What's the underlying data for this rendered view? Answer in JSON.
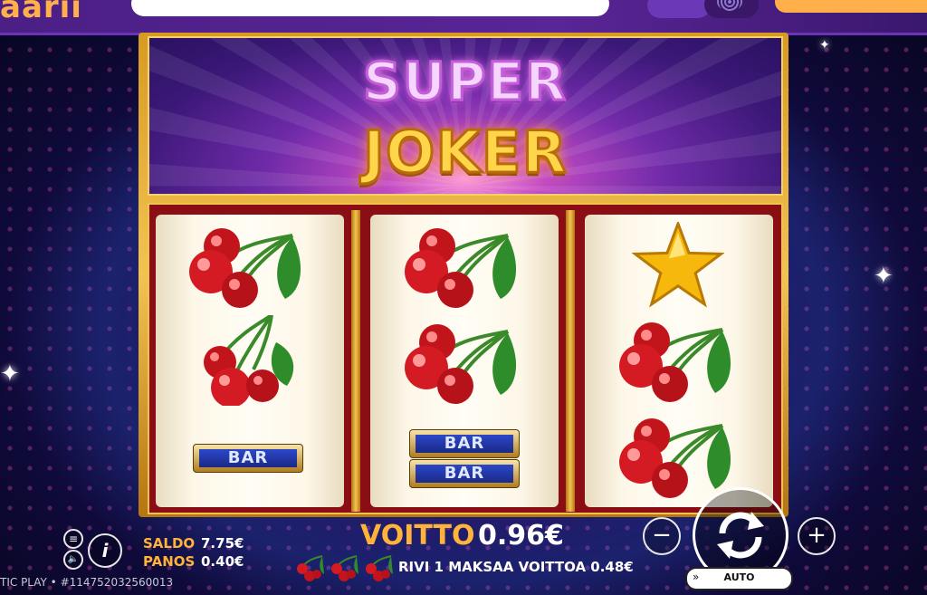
{
  "site": {
    "logo_partial": "aarii"
  },
  "game": {
    "title_line1": "SUPER",
    "title_line2": "JOKER"
  },
  "reels": [
    {
      "symbols": [
        "cherry",
        "cherry",
        "bar"
      ]
    },
    {
      "symbols": [
        "cherry",
        "cherry",
        "bar-bar"
      ]
    },
    {
      "symbols": [
        "star",
        "cherry",
        "cherry"
      ]
    }
  ],
  "bar_label": "BAR",
  "hud": {
    "saldo_label": "SALDO",
    "saldo_value": "7.75€",
    "panos_label": "PANOS",
    "panos_value": "0.40€",
    "win_label": "VOITTO",
    "win_value": "0.96€",
    "pays_text": "RIVI 1 MAKSAA VOITTOA 0.48€",
    "auto_label": "AUTO",
    "info_glyph": "i",
    "minus_glyph": "−",
    "plus_glyph": "+",
    "menu_glyph": "≡",
    "sound_glyph": "🔈",
    "footer": "TIC PLAY  • #114752032560013"
  },
  "colors": {
    "accent_gold": "#ffb338",
    "frame_gold": "#f3c350",
    "reel_red": "#8a0e14"
  },
  "icons": [
    "menu-icon",
    "sound-icon",
    "info-icon",
    "minus-icon",
    "plus-icon",
    "spin-icon",
    "autoplay-icon",
    "cherry-icon",
    "star-icon",
    "bar-icon"
  ]
}
